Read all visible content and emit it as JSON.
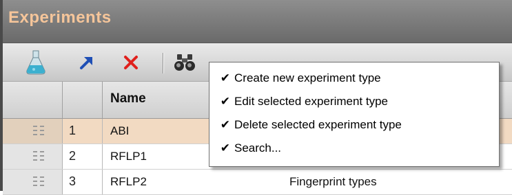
{
  "window": {
    "title": "Experiments"
  },
  "toolbar": {
    "buttons": [
      {
        "icon": "flask-icon",
        "label": ""
      },
      {
        "icon": "arrow-edit-icon",
        "label": ""
      },
      {
        "icon": "delete-x-icon",
        "label": ""
      },
      {
        "icon": "binoculars-search-icon",
        "label": ""
      }
    ]
  },
  "grid": {
    "header": {
      "name": "Name"
    },
    "rows": [
      {
        "num": "1",
        "name": "ABI",
        "type": "",
        "selected": true
      },
      {
        "num": "2",
        "name": "RFLP1",
        "type": ""
      },
      {
        "num": "3",
        "name": "RFLP2",
        "type": "Fingerprint types"
      }
    ]
  },
  "context_menu": {
    "check_glyph": "✔",
    "items": [
      {
        "label": "Create new experiment type"
      },
      {
        "label": "Edit selected experiment type"
      },
      {
        "label": "Delete selected experiment type"
      },
      {
        "label": "Search..."
      }
    ]
  },
  "colors": {
    "title_text": "#f5c59a",
    "selected_row": "#f2dac2",
    "delete_red": "#e0201c",
    "arrow_blue": "#1f4fb5"
  }
}
